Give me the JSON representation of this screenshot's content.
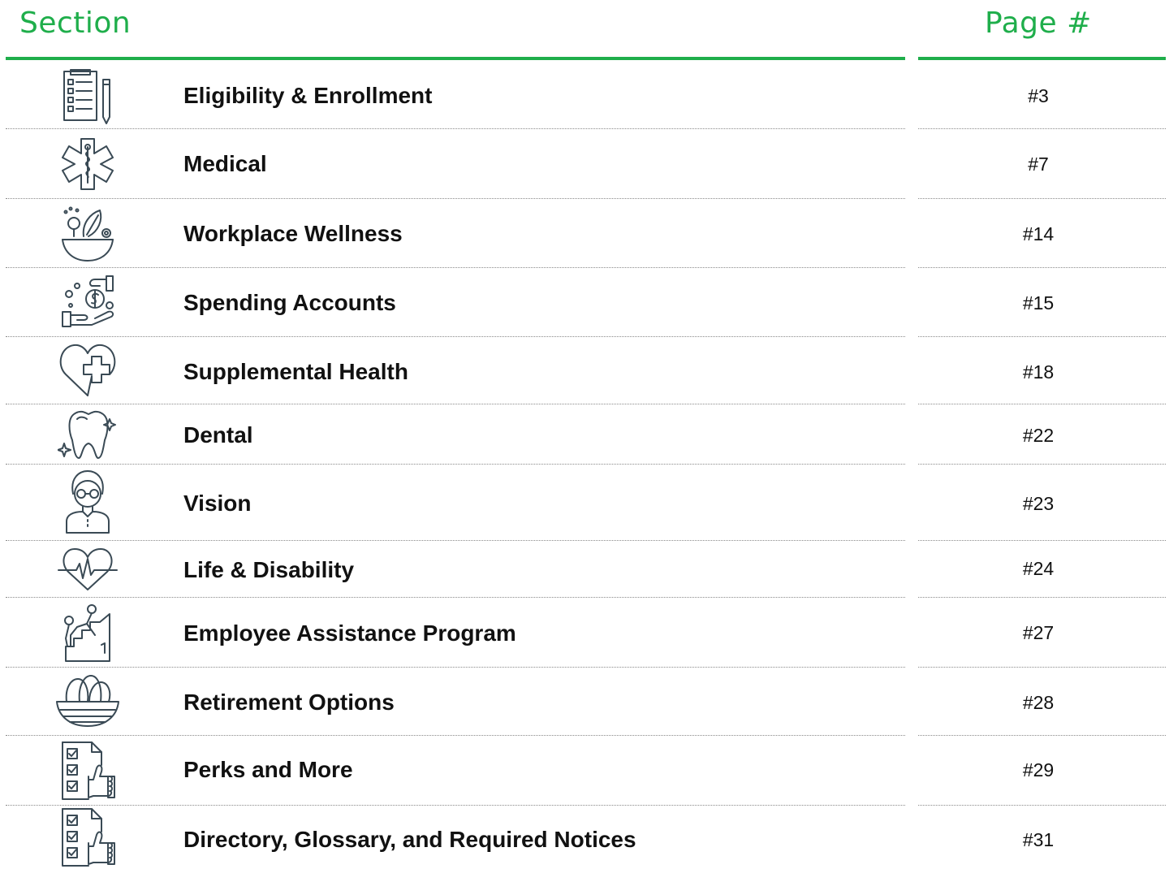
{
  "header": {
    "section_label": "Section",
    "page_label": "Page #"
  },
  "colors": {
    "accent": "#1fae4b",
    "text": "#111111",
    "icon_stroke": "#3a4a55",
    "separator": "#8a8a8a"
  },
  "rows": [
    {
      "icon": "clipboard-pencil-icon",
      "label": "Eligibility & Enrollment",
      "page": "#3"
    },
    {
      "icon": "medical-star-icon",
      "label": "Medical",
      "page": "#7"
    },
    {
      "icon": "salad-bowl-icon",
      "label": "Workplace Wellness",
      "page": "#14"
    },
    {
      "icon": "money-hand-icon",
      "label": "Spending Accounts",
      "page": "#15"
    },
    {
      "icon": "heart-plus-icon",
      "label": "Supplemental Health",
      "page": "#18"
    },
    {
      "icon": "tooth-icon",
      "label": "Dental",
      "page": "#22"
    },
    {
      "icon": "person-glasses-icon",
      "label": "Vision",
      "page": "#23"
    },
    {
      "icon": "heartbeat-icon",
      "label": "Life & Disability",
      "page": "#24"
    },
    {
      "icon": "helping-climb-icon",
      "label": "Employee Assistance Program",
      "page": "#27"
    },
    {
      "icon": "nest-eggs-icon",
      "label": "Retirement Options",
      "page": "#28"
    },
    {
      "icon": "checklist-thumbs-up-icon",
      "label": "Perks and More",
      "page": "#29"
    },
    {
      "icon": "checklist-thumbs-up-icon",
      "label": "Directory, Glossary, and Required Notices",
      "page": "#31"
    }
  ]
}
